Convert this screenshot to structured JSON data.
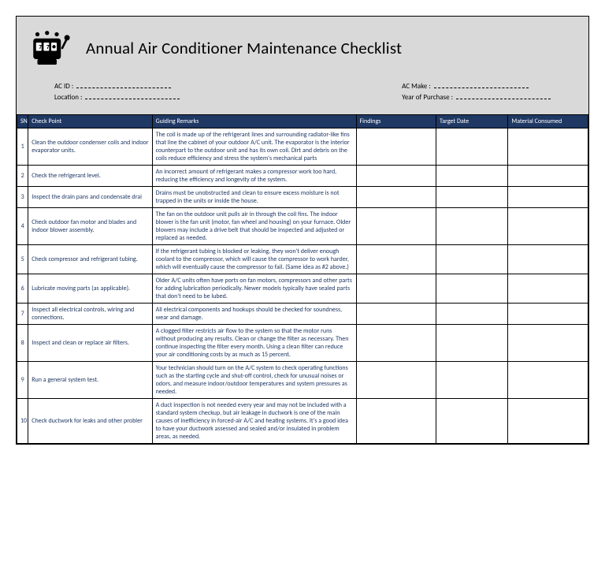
{
  "title": "Annual Air Conditioner Maintenance Checklist",
  "meta": {
    "ac_id_label": "AC ID :",
    "location_label": "Location :",
    "ac_make_label": "AC Make :",
    "year_label": "Year of Purchase :"
  },
  "columns": {
    "sn": "SN",
    "check_point": "Check Point",
    "guiding": "Guiding Remarks",
    "findings": "Findings",
    "target": "Target Date",
    "material": "Material Consumed"
  },
  "rows": [
    {
      "sn": "1",
      "check_point": "Clean the outdoor condenser coils and indoor evaporator units.",
      "guiding": "The coil is made up of the refrigerant lines and surrounding radiator-like fins that line the cabinet of your outdoor A/C unit. The evaporator is the interior counterpart to the outdoor unit and has its own coil. Dirt and debris on the coils reduce efficiency and stress the system's mechanical parts"
    },
    {
      "sn": "2",
      "check_point": "Check the refrigerant level.",
      "guiding": "An incorrect amount of refrigerant makes a compressor work too hard, reducing the efficiency and longevity of the system."
    },
    {
      "sn": "3",
      "check_point": "Inspect the drain pans and condensate drai",
      "guiding": "Drains must be unobstructed and clean to ensure excess moisture is not trapped in the units or inside the house."
    },
    {
      "sn": "4",
      "check_point": "Check outdoor fan motor and blades and indoor blower assembly.",
      "guiding": "The fan on the outdoor unit pulls air in through the coil fins. The indoor blower is the fan unit (motor, fan wheel and housing) on your furnace. Older blowers may include a drive belt that should be inspected and adjusted or replaced as needed."
    },
    {
      "sn": "5",
      "check_point": "Check compressor and refrigerant tubing.",
      "guiding": "If the refrigerant tubing is blocked or leaking, they won't deliver enough coolant to the compressor, which will cause the compressor to work harder, which will eventually cause the compressor to fail. (Same idea as #2 above.)"
    },
    {
      "sn": "6",
      "check_point": "Lubricate moving parts (as applicable).",
      "guiding": "Older A/C units often have ports on fan motors, compressors and other parts for adding lubrication periodically. Newer models typically have sealed parts that don't need to be lubed."
    },
    {
      "sn": "7",
      "check_point": "Inspect all electrical controls, wiring and connections.",
      "guiding": "All electrical components and hookups should be checked for soundness, wear and damage."
    },
    {
      "sn": "8",
      "check_point": "Inspect and clean or replace air filters.",
      "guiding": "A clogged filter restricts air flow to the system so that the motor runs without producing any results. Clean or change the filter as necessary. Then continue inspecting the filter every month. Using a clean filter can reduce your air conditioning costs by as much as 15 percent."
    },
    {
      "sn": "9",
      "check_point": "Run a general system test.",
      "guiding": "Your technician should turn on the A/C system to check operating functions such as the starting cycle and shut-off control, check for unusual noises or odors, and measure indoor/outdoor temperatures and system pressures as needed."
    },
    {
      "sn": "10",
      "check_point": "Check ductwork for leaks and other probler",
      "guiding": "A duct inspection is not needed every year and may not be included with a standard system checkup, but air leakage in ductwork is one of the main causes of inefficiency in forced-air A/C and heating systems. It's a good idea to have your ductwork assessed and sealed and/or insulated in problem areas, as needed."
    }
  ]
}
